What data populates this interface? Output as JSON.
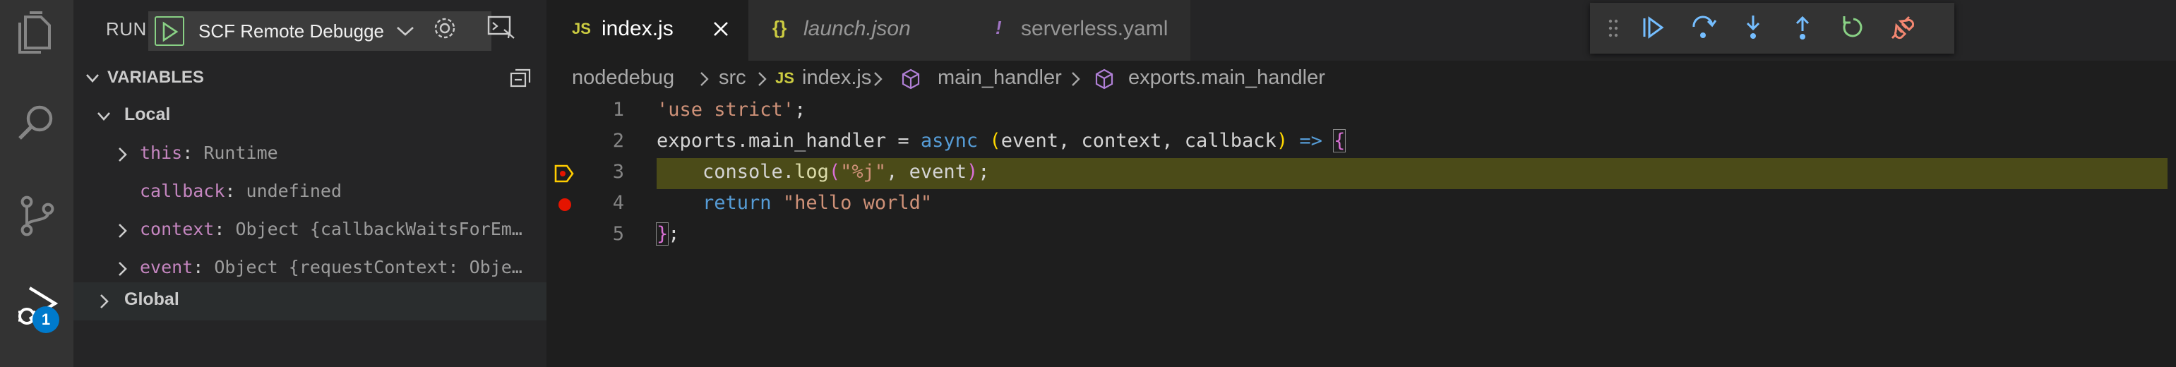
{
  "run_panel": {
    "title": "RUN",
    "config_name": "SCF Remote Debugge",
    "settings_icon": "gear-icon",
    "console_icon": "debug-console-icon"
  },
  "variables": {
    "title": "VARIABLES",
    "scopes": [
      {
        "label": "Local",
        "expanded": true,
        "items": [
          {
            "name": "this",
            "value": "Runtime",
            "expandable": true
          },
          {
            "name": "callback",
            "value": "undefined",
            "expandable": false
          },
          {
            "name": "context",
            "value": "Object {callbackWaitsForEm…",
            "expandable": true
          },
          {
            "name": "event",
            "value": "Object {requestContext: Obje…",
            "expandable": true
          }
        ]
      },
      {
        "label": "Global",
        "expanded": false,
        "items": []
      }
    ]
  },
  "activity_bar": {
    "items": [
      "explorer-icon",
      "search-icon",
      "source-control-icon",
      "run-debug-icon"
    ],
    "badge": "1"
  },
  "tabs": [
    {
      "icon": "JS",
      "label": "index.js",
      "active": true
    },
    {
      "icon": "{}",
      "label": "launch.json",
      "active": false
    },
    {
      "icon": "!",
      "label": "serverless.yaml",
      "active": false
    }
  ],
  "breadcrumb": [
    "nodedebug",
    "src",
    "index.js",
    "main_handler",
    "exports.main_handler"
  ],
  "editor": {
    "lines": [
      {
        "num": "1"
      },
      {
        "num": "2"
      },
      {
        "num": "3"
      },
      {
        "num": "4"
      },
      {
        "num": "5"
      }
    ],
    "current_line": "3",
    "breakpoint_line": "4"
  },
  "colors": {
    "accent": "#007acc",
    "current_line_bg": "#4b4b18",
    "breakpoint": "#e51400",
    "start_green": "#89d185"
  }
}
